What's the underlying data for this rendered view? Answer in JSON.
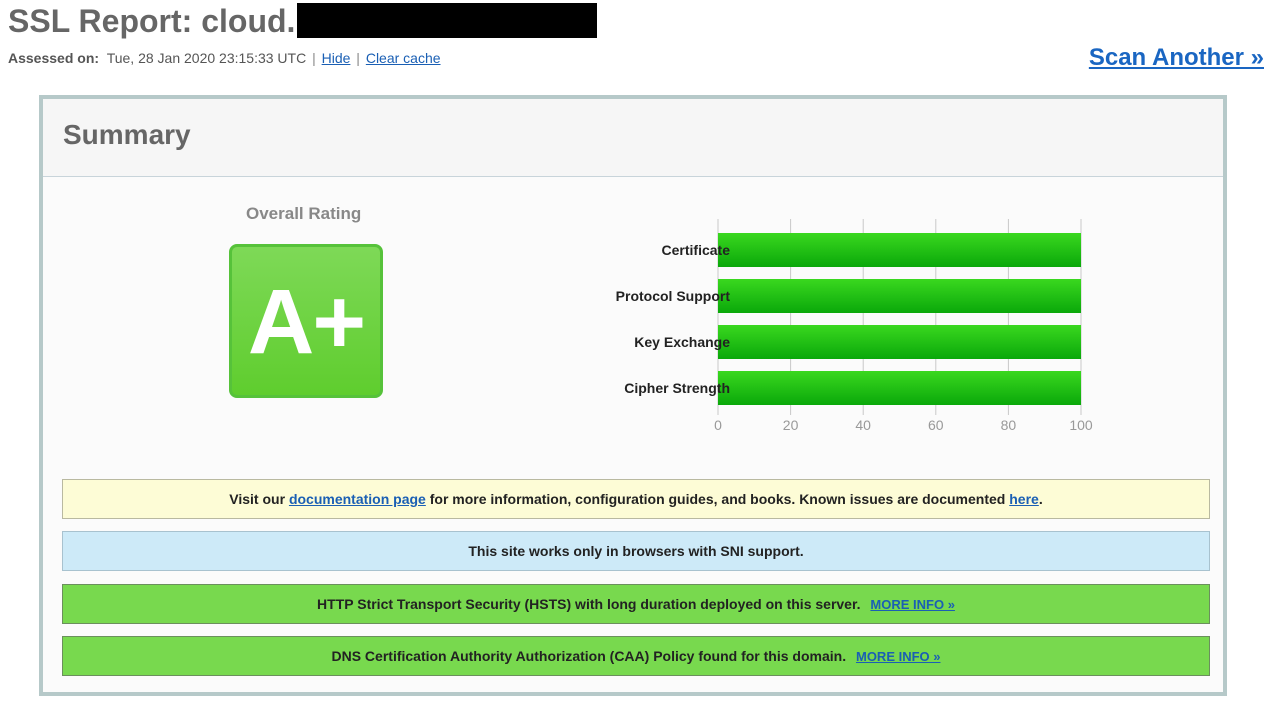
{
  "header": {
    "title_prefix": "SSL Report: cloud.",
    "assessed_label": "Assessed on:",
    "assessed_value": "Tue, 28 Jan 2020 23:15:33 UTC",
    "hide_link": "Hide",
    "clear_cache_link": "Clear cache",
    "scan_another": "Scan Another »"
  },
  "summary": {
    "heading": "Summary",
    "overall_rating_label": "Overall Rating",
    "grade": "A+",
    "grade_color": "#66cc33"
  },
  "chart_data": {
    "type": "bar",
    "orientation": "horizontal",
    "categories": [
      "Certificate",
      "Protocol Support",
      "Key Exchange",
      "Cipher Strength"
    ],
    "values": [
      100,
      100,
      100,
      100
    ],
    "xlim": [
      0,
      100
    ],
    "ticks": [
      "0",
      "20",
      "40",
      "60",
      "80",
      "100"
    ],
    "grid": true,
    "bar_color": "#22bb11"
  },
  "notices": {
    "documentation": {
      "before": "Visit our",
      "link1": "documentation page",
      "middle": "for more information, configuration guides, and books. Known issues are documented",
      "link2": "here",
      "after": "."
    },
    "sni": "This site works only in browsers with SNI support.",
    "hsts": {
      "text": "HTTP Strict Transport Security (HSTS) with long duration deployed on this server.",
      "more": "MORE INFO »"
    },
    "caa": {
      "text": "DNS Certification Authority Authorization (CAA) Policy found for this domain.",
      "more": "MORE INFO »"
    }
  }
}
